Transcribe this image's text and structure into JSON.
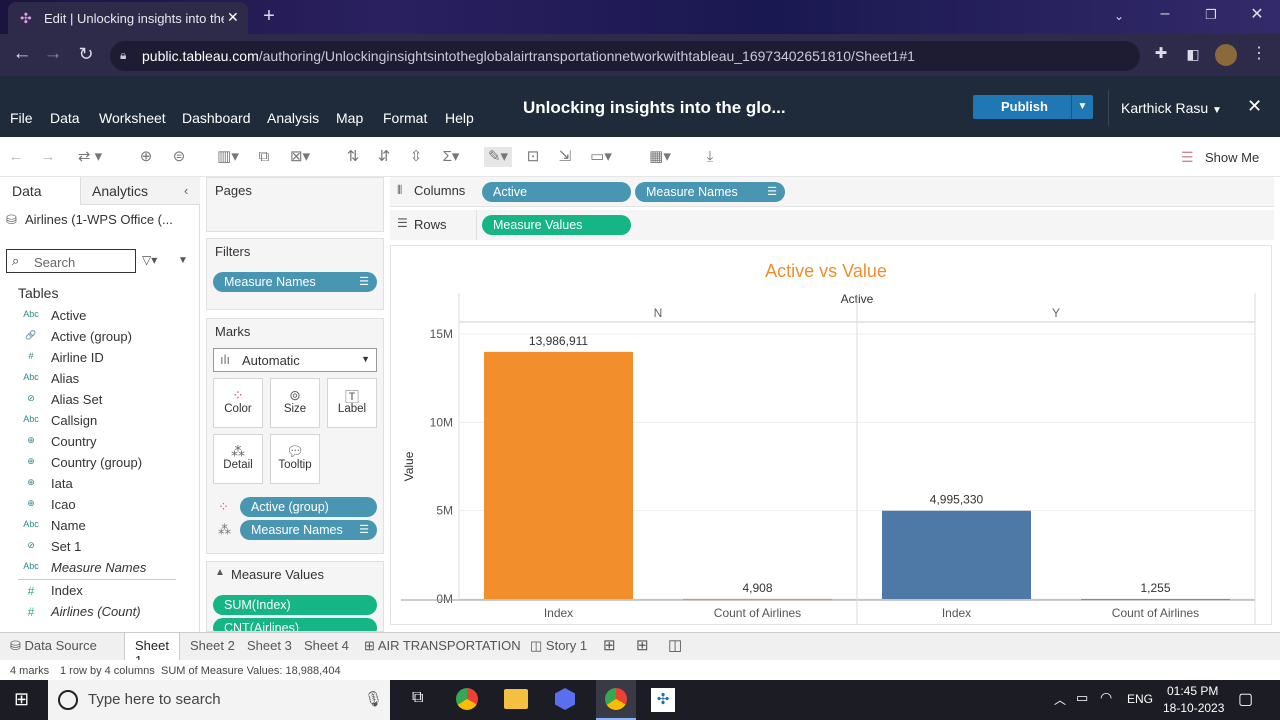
{
  "browser": {
    "tab_title": "Edit | Unlocking insights into the",
    "url_host": "public.tableau.com",
    "url_path": "/authoring/Unlockinginsightsintotheglobalairtransportationnetworkwithtableau_16973402651810/Sheet1#1"
  },
  "menu": [
    "File",
    "Data",
    "Worksheet",
    "Dashboard",
    "Analysis",
    "Map",
    "Format",
    "Help"
  ],
  "workbook_title": "Unlocking insights into the glo...",
  "publish_label": "Publish",
  "user_name": "Karthick Rasu",
  "show_me": "Show Me",
  "data_pane": {
    "tab_data": "Data",
    "tab_analytics": "Analytics",
    "datasource": "Airlines (1-WPS Office (...",
    "search_placeholder": "Search",
    "tables_heading": "Tables",
    "fields": [
      {
        "icon": "Abc",
        "name": "Active"
      },
      {
        "icon": "🔗",
        "name": "Active (group)"
      },
      {
        "icon": "#",
        "name": "Airline ID"
      },
      {
        "icon": "Abc",
        "name": "Alias"
      },
      {
        "icon": "⊘",
        "name": "Alias Set"
      },
      {
        "icon": "Abc",
        "name": "Callsign"
      },
      {
        "icon": "⊕",
        "name": "Country"
      },
      {
        "icon": "⊕",
        "name": "Country (group)"
      },
      {
        "icon": "⊕",
        "name": "Iata"
      },
      {
        "icon": "⊕",
        "name": "Icao"
      },
      {
        "icon": "Abc",
        "name": "Name"
      },
      {
        "icon": "⊘",
        "name": "Set 1"
      },
      {
        "icon": "Abc",
        "name": "Measure Names"
      }
    ],
    "measures": [
      {
        "icon": "#",
        "name": "Index"
      },
      {
        "icon": "#",
        "name": "Airlines (Count)"
      }
    ]
  },
  "pages_label": "Pages",
  "filters_label": "Filters",
  "filter_pill": "Measure Names",
  "marks_label": "Marks",
  "marks_type": "Automatic",
  "mark_buttons": [
    "Color",
    "Size",
    "Label",
    "Detail",
    "Tooltip"
  ],
  "marks_pills": [
    "Active (group)",
    "Measure Names"
  ],
  "measure_values_label": "Measure Values",
  "measure_values_pills": [
    "SUM(Index)",
    "CNT(Airlines)"
  ],
  "columns_label": "Columns",
  "columns_pills": [
    "Active",
    "Measure Names"
  ],
  "rows_label": "Rows",
  "rows_pills": [
    "Measure Values"
  ],
  "chart_data": {
    "type": "bar",
    "title": "Active vs Value",
    "header": "Active",
    "panes": [
      {
        "name": "N",
        "categories": [
          "Index",
          "Count of Airlines"
        ],
        "values": [
          13986911,
          4908
        ],
        "labels": [
          "13,986,911",
          "4,908"
        ],
        "colors": [
          "#f28e2b",
          "#f28e2b"
        ]
      },
      {
        "name": "Y",
        "categories": [
          "Index",
          "Count of Airlines"
        ],
        "values": [
          4995330,
          1255
        ],
        "labels": [
          "4,995,330",
          "1,255"
        ],
        "colors": [
          "#4e79a7",
          "#4e79a7"
        ]
      }
    ],
    "ylabel": "Value",
    "yticks": [
      "15M",
      "10M",
      "5M",
      "0M"
    ],
    "ytick_values": [
      15000000,
      10000000,
      5000000,
      0
    ],
    "ylim": [
      0,
      15000000
    ]
  },
  "sheet_tabs": [
    "Data Source",
    "Sheet 1",
    "Sheet 2",
    "Sheet 3",
    "Sheet 4",
    "AIR TRANSPORTATION",
    "Story 1"
  ],
  "status": {
    "marks": "4 marks",
    "rows_cols": "1 row by 4 columns",
    "sum": "SUM of Measure Values: 18,988,404"
  },
  "taskbar": {
    "search_placeholder": "Type here to search",
    "lang": "ENG",
    "time": "01:45 PM",
    "date": "18-10-2023"
  }
}
